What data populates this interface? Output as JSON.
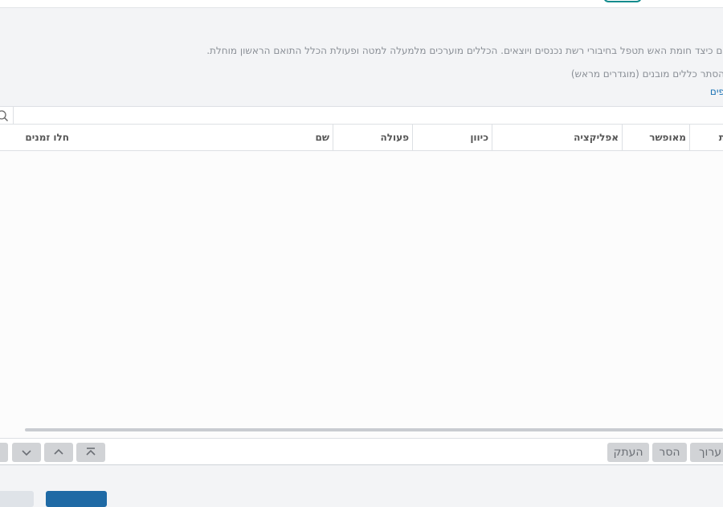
{
  "header": {
    "description": "ים כיצד חומת האש תטפל בחיבורי רשת נכנסים ויוצאים. הכללים מוערכים מלמעלה למטה ופעולת הכלל התואם הראשון מוחלת.",
    "hide_builtin_rules": "הסתר כללים מובנים (מוגדרים מראש)",
    "more_link": "פים"
  },
  "search": {
    "value": "",
    "placeholder": ""
  },
  "table": {
    "columns": [
      "חלו זמנים",
      "שם",
      "פעולה",
      "כיוון",
      "אפליקציה",
      "מאופשר",
      "ת"
    ],
    "rows": []
  },
  "toolbar": {
    "edit_label": "ערוך",
    "remove_label": "הסר",
    "copy_label": "העתק"
  },
  "colors": {
    "accent": "#0f8b8d",
    "link": "#1a73b5",
    "primary_button": "#1f6aa5"
  },
  "icons": [
    "search-icon",
    "chevron-down-icon",
    "chevron-up-icon",
    "move-to-top-icon"
  ]
}
